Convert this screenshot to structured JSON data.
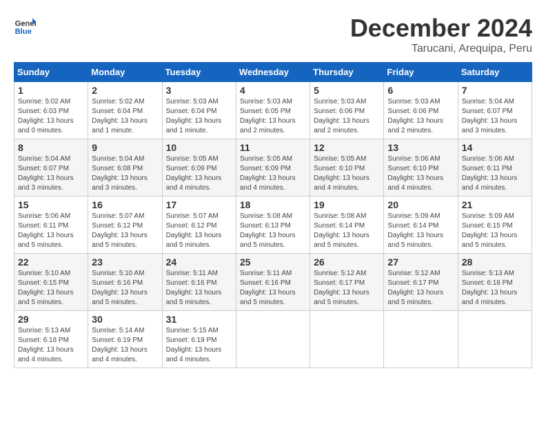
{
  "logo": {
    "line1": "General",
    "line2": "Blue"
  },
  "title": "December 2024",
  "location": "Tarucani, Arequipa, Peru",
  "weekdays": [
    "Sunday",
    "Monday",
    "Tuesday",
    "Wednesday",
    "Thursday",
    "Friday",
    "Saturday"
  ],
  "weeks": [
    [
      {
        "day": 1,
        "sunrise": "5:02 AM",
        "sunset": "6:03 PM",
        "daylight": "13 hours and 0 minutes."
      },
      {
        "day": 2,
        "sunrise": "5:02 AM",
        "sunset": "6:04 PM",
        "daylight": "13 hours and 1 minute."
      },
      {
        "day": 3,
        "sunrise": "5:03 AM",
        "sunset": "6:04 PM",
        "daylight": "13 hours and 1 minute."
      },
      {
        "day": 4,
        "sunrise": "5:03 AM",
        "sunset": "6:05 PM",
        "daylight": "13 hours and 2 minutes."
      },
      {
        "day": 5,
        "sunrise": "5:03 AM",
        "sunset": "6:06 PM",
        "daylight": "13 hours and 2 minutes."
      },
      {
        "day": 6,
        "sunrise": "5:03 AM",
        "sunset": "6:06 PM",
        "daylight": "13 hours and 2 minutes."
      },
      {
        "day": 7,
        "sunrise": "5:04 AM",
        "sunset": "6:07 PM",
        "daylight": "13 hours and 3 minutes."
      }
    ],
    [
      {
        "day": 8,
        "sunrise": "5:04 AM",
        "sunset": "6:07 PM",
        "daylight": "13 hours and 3 minutes."
      },
      {
        "day": 9,
        "sunrise": "5:04 AM",
        "sunset": "6:08 PM",
        "daylight": "13 hours and 3 minutes."
      },
      {
        "day": 10,
        "sunrise": "5:05 AM",
        "sunset": "6:09 PM",
        "daylight": "13 hours and 4 minutes."
      },
      {
        "day": 11,
        "sunrise": "5:05 AM",
        "sunset": "6:09 PM",
        "daylight": "13 hours and 4 minutes."
      },
      {
        "day": 12,
        "sunrise": "5:05 AM",
        "sunset": "6:10 PM",
        "daylight": "13 hours and 4 minutes."
      },
      {
        "day": 13,
        "sunrise": "5:06 AM",
        "sunset": "6:10 PM",
        "daylight": "13 hours and 4 minutes."
      },
      {
        "day": 14,
        "sunrise": "5:06 AM",
        "sunset": "6:11 PM",
        "daylight": "13 hours and 4 minutes."
      }
    ],
    [
      {
        "day": 15,
        "sunrise": "5:06 AM",
        "sunset": "6:11 PM",
        "daylight": "13 hours and 5 minutes."
      },
      {
        "day": 16,
        "sunrise": "5:07 AM",
        "sunset": "6:12 PM",
        "daylight": "13 hours and 5 minutes."
      },
      {
        "day": 17,
        "sunrise": "5:07 AM",
        "sunset": "6:12 PM",
        "daylight": "13 hours and 5 minutes."
      },
      {
        "day": 18,
        "sunrise": "5:08 AM",
        "sunset": "6:13 PM",
        "daylight": "13 hours and 5 minutes."
      },
      {
        "day": 19,
        "sunrise": "5:08 AM",
        "sunset": "6:14 PM",
        "daylight": "13 hours and 5 minutes."
      },
      {
        "day": 20,
        "sunrise": "5:09 AM",
        "sunset": "6:14 PM",
        "daylight": "13 hours and 5 minutes."
      },
      {
        "day": 21,
        "sunrise": "5:09 AM",
        "sunset": "6:15 PM",
        "daylight": "13 hours and 5 minutes."
      }
    ],
    [
      {
        "day": 22,
        "sunrise": "5:10 AM",
        "sunset": "6:15 PM",
        "daylight": "13 hours and 5 minutes."
      },
      {
        "day": 23,
        "sunrise": "5:10 AM",
        "sunset": "6:16 PM",
        "daylight": "13 hours and 5 minutes."
      },
      {
        "day": 24,
        "sunrise": "5:11 AM",
        "sunset": "6:16 PM",
        "daylight": "13 hours and 5 minutes."
      },
      {
        "day": 25,
        "sunrise": "5:11 AM",
        "sunset": "6:16 PM",
        "daylight": "13 hours and 5 minutes."
      },
      {
        "day": 26,
        "sunrise": "5:12 AM",
        "sunset": "6:17 PM",
        "daylight": "13 hours and 5 minutes."
      },
      {
        "day": 27,
        "sunrise": "5:12 AM",
        "sunset": "6:17 PM",
        "daylight": "13 hours and 5 minutes."
      },
      {
        "day": 28,
        "sunrise": "5:13 AM",
        "sunset": "6:18 PM",
        "daylight": "13 hours and 4 minutes."
      }
    ],
    [
      {
        "day": 29,
        "sunrise": "5:13 AM",
        "sunset": "6:18 PM",
        "daylight": "13 hours and 4 minutes."
      },
      {
        "day": 30,
        "sunrise": "5:14 AM",
        "sunset": "6:19 PM",
        "daylight": "13 hours and 4 minutes."
      },
      {
        "day": 31,
        "sunrise": "5:15 AM",
        "sunset": "6:19 PM",
        "daylight": "13 hours and 4 minutes."
      },
      null,
      null,
      null,
      null
    ]
  ]
}
